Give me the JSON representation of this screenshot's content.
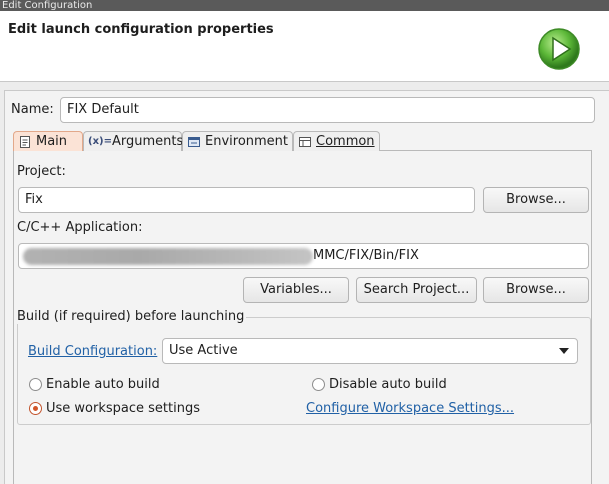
{
  "window": {
    "title": "Edit Configuration"
  },
  "header": {
    "title": "Edit launch configuration properties",
    "icon": "run-icon",
    "accent": "#6cc04a"
  },
  "name_field": {
    "label": "Name:",
    "value": "FIX Default"
  },
  "tabs": [
    {
      "label": "Main",
      "icon": "document-icon",
      "active": true
    },
    {
      "label": "Arguments",
      "icon": "arguments-icon",
      "active": false
    },
    {
      "label": "Environment",
      "icon": "environment-icon",
      "active": false
    },
    {
      "label": "Common",
      "icon": "common-icon",
      "active": false
    }
  ],
  "project": {
    "label": "Project:",
    "value": "Fix",
    "browse_label": "Browse..."
  },
  "application": {
    "label": "C/C++ Application:",
    "value_visible": "MMC/FIX/Bin/FIX",
    "variables_label": "Variables...",
    "search_label": "Search Project...",
    "browse_label": "Browse..."
  },
  "build": {
    "group_label": "Build (if required) before launching",
    "config_link": "Build Configuration:",
    "config_value": "Use Active",
    "enable_auto": "Enable auto build",
    "disable_auto": "Disable auto build",
    "use_workspace": "Use workspace settings",
    "configure_link": "Configure Workspace Settings...",
    "selected": "use_workspace"
  }
}
